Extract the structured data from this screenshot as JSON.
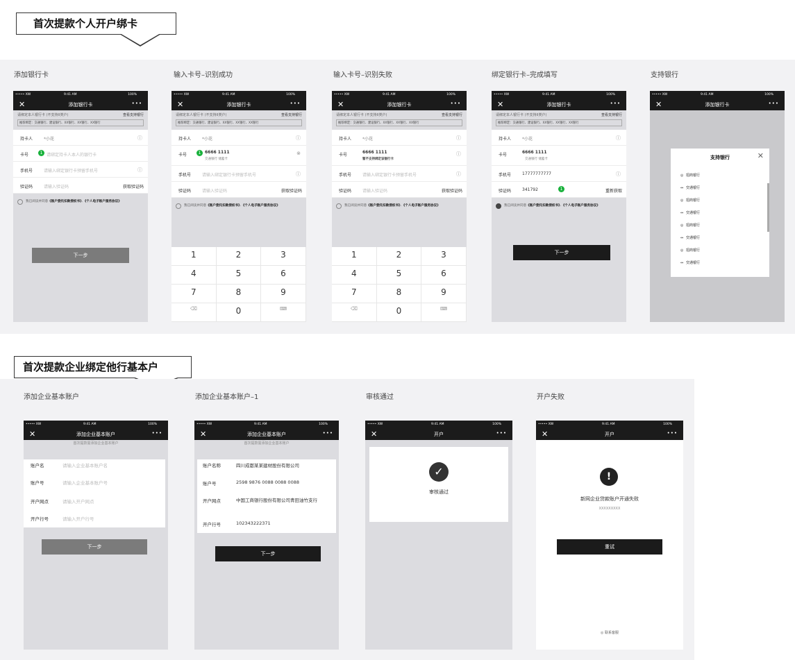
{
  "section1": {
    "title": "首次提款个人开户绑卡",
    "columns": [
      {
        "label": "添加银行卡"
      },
      {
        "label": "输入卡号–识别成功"
      },
      {
        "label": "输入卡号–识别失败"
      },
      {
        "label": "绑定银行卡–完成填写"
      },
      {
        "label": "支持银行"
      }
    ]
  },
  "section2": {
    "title": "首次提款企业绑定他行基本户",
    "columns": [
      {
        "label": "添加企业基本账户"
      },
      {
        "label": "添加企业基本账户–1"
      },
      {
        "label": "审核通过"
      },
      {
        "label": "开户失败"
      }
    ]
  },
  "status": {
    "carrier": "••••• XW",
    "wifi": "▾",
    "time": "9:41 AM",
    "battery": "100%"
  },
  "nav": {
    "close": "✕",
    "more": "•••",
    "add_card_title": "添加银行卡",
    "add_corp_title": "添加企业基本账户",
    "open_title": "开户"
  },
  "card_form": {
    "hint": "请绑定本人银行卡 (不支持II类户)",
    "hint_link": "查看支持银行",
    "recommended": "推荐绑定：交通银行、建设银行、XX银行、XX银行、XX银行",
    "holder_label": "持卡人",
    "holder_value": "*小花",
    "card_label": "卡号",
    "card_placeholder": "请绑定持卡人本人的银行卡",
    "card_value": "6666 1111",
    "bank_ok": "交通银行 储蓄卡",
    "bank_fail": "暂不支持绑定该银行卡",
    "phone_label": "手机号",
    "phone_placeholder": "请输入绑定银行卡预留手机号",
    "phone_value": "17777777777",
    "code_label": "验证码",
    "code_placeholder": "请输入验证码",
    "code_value": "341792",
    "get_code": "获取验证码",
    "resend": "重新获取",
    "agree_prefix": "我已阅读并同意",
    "agree_doc1": "《账户委托扣款授权书》",
    "agree_sep": "、",
    "agree_doc2": "《个人电子账户服务协议》",
    "next": "下一步",
    "step1": "1",
    "info": "ⓘ",
    "clear": "⊗"
  },
  "keypad": [
    "1",
    "2",
    "3",
    "4",
    "5",
    "6",
    "7",
    "8",
    "9",
    "⌫",
    "0",
    "⌨"
  ],
  "support_modal": {
    "title": "支持银行",
    "close": "✕",
    "banks": [
      "招商银行",
      "交通银行",
      "招商银行",
      "交通银行",
      "招商银行",
      "交通银行",
      "招商银行",
      "交通银行"
    ]
  },
  "corp_form": {
    "top_hint": "首次提款需添加企业基本账户",
    "name_label": "账户名",
    "name_placeholder": "请输入企业基本账户名",
    "acct_label": "账户号",
    "acct_placeholder": "请输入企业基本账户号",
    "branch_label": "开户网点",
    "branch_placeholder": "请输入开户网点",
    "bankno_label": "开户行号",
    "bankno_placeholder": "请输入开户行号",
    "name_label_filled": "账户名称",
    "name_value": "四川成都某某建材股份有限公司",
    "acct_value": "2598 9876 0088 0088 0088",
    "branch_value": "中国工商银行股份有限公司青田油竹支行",
    "bankno_value": "102343222371",
    "next": "下一步"
  },
  "approved": {
    "icon": "✓",
    "text": "审核通过"
  },
  "failed": {
    "icon": "!",
    "text": "新网企业贷款账户开通失败",
    "code": "XXXXXXXXX",
    "retry": "重试",
    "contact": "联系客服",
    "contact_icon": "◎"
  }
}
